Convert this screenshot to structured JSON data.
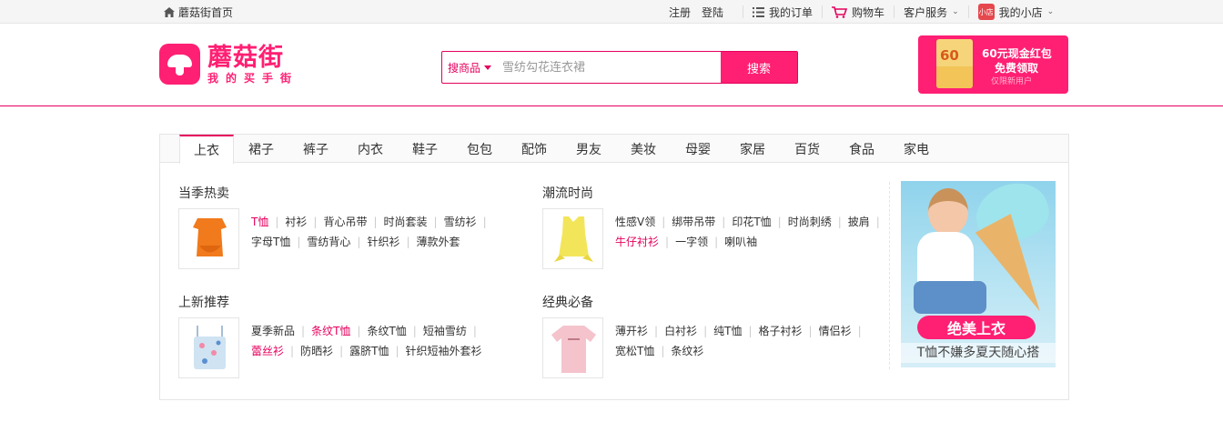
{
  "topbar": {
    "home_label": "蘑菇街首页",
    "register": "注册",
    "login": "登陆",
    "orders": "我的订单",
    "cart": "购物车",
    "service": "客户服务",
    "shop_badge": "小店",
    "shop": "我的小店"
  },
  "header": {
    "logo_text": "蘑菇街",
    "logo_sub": "我的买手街",
    "search_type": "搜商品",
    "search_placeholder": "雪纺勾花连衣裙",
    "search_button": "搜索",
    "promo_amount": "60",
    "promo_line1": "60元现金红包",
    "promo_line2": "免费领取",
    "promo_line3": "仅限新用户"
  },
  "tabs": [
    "上衣",
    "裙子",
    "裤子",
    "内衣",
    "鞋子",
    "包包",
    "配饰",
    "男友",
    "美妆",
    "母婴",
    "家居",
    "百货",
    "食品",
    "家电"
  ],
  "groups": [
    {
      "title": "当季热卖",
      "links": [
        {
          "t": "T恤",
          "hot": true
        },
        {
          "t": "衬衫"
        },
        {
          "t": "背心吊带"
        },
        {
          "t": "时尚套装"
        },
        {
          "t": "雪纺衫"
        },
        {
          "t": "字母T恤"
        },
        {
          "t": "雪纺背心"
        },
        {
          "t": "针织衫"
        },
        {
          "t": "薄款外套"
        }
      ],
      "row_break": 5
    },
    {
      "title": "潮流时尚",
      "links": [
        {
          "t": "性感V领"
        },
        {
          "t": "绑带吊带"
        },
        {
          "t": "印花T恤"
        },
        {
          "t": "时尚刺绣"
        },
        {
          "t": "披肩"
        },
        {
          "t": "牛仔衬衫",
          "hot": true
        },
        {
          "t": "一字领"
        },
        {
          "t": "喇叭袖"
        }
      ],
      "row_break": 5
    },
    {
      "title": "上新推荐",
      "links": [
        {
          "t": "夏季新品"
        },
        {
          "t": "条纹T恤",
          "hot": true
        },
        {
          "t": "条纹T恤"
        },
        {
          "t": "短袖雪纺"
        },
        {
          "t": "蕾丝衫",
          "hot": true
        },
        {
          "t": "防晒衫"
        },
        {
          "t": "露脐T恤"
        },
        {
          "t": "针织短袖外套衫"
        }
      ],
      "row_break": 4
    },
    {
      "title": "经典必备",
      "links": [
        {
          "t": "薄开衫"
        },
        {
          "t": "白衬衫"
        },
        {
          "t": "纯T恤"
        },
        {
          "t": "格子衬衫"
        },
        {
          "t": "情侣衫"
        },
        {
          "t": "宽松T恤"
        },
        {
          "t": "条纹衫"
        }
      ],
      "row_break": 5
    }
  ],
  "banner": {
    "title": "绝美上衣",
    "subtitle": "T恤不嫌多夏天随心搭"
  },
  "colors": {
    "brand": "#ff1f73",
    "accent": "#e5005d"
  }
}
